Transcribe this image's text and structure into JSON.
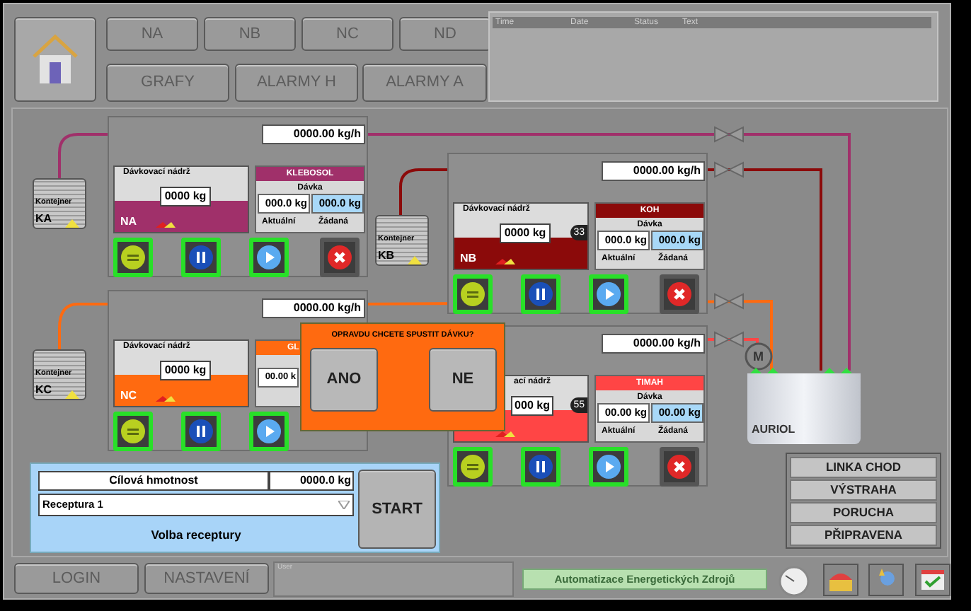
{
  "nav": {
    "row1": [
      "NA",
      "NB",
      "NC",
      "ND"
    ],
    "row2": [
      "GRAFY",
      "ALARMY H",
      "ALARMY A"
    ]
  },
  "alarm_view": {
    "columns": [
      "Time",
      "Date",
      "Status",
      "Text"
    ]
  },
  "units": [
    {
      "name": "NA",
      "color": "#a0306a",
      "tank_label": "Dávkovací nádrž",
      "tank_value": "0000 kg",
      "flow": "0000.00 kg/h",
      "recipe": {
        "title": "KLEBOSOL",
        "dose_label": "Dávka",
        "actual_value": "000.0 kg",
        "target_value": "000.0 kg",
        "actual_label": "Aktuální",
        "target_label": "Žádaná"
      },
      "buttons": [
        {
          "kind": "stop",
          "highlighted": true
        },
        {
          "kind": "pause",
          "highlighted": true
        },
        {
          "kind": "play",
          "highlighted": true
        },
        {
          "kind": "cancel",
          "highlighted": false
        }
      ]
    },
    {
      "name": "NB",
      "color": "#8b0a0a",
      "tank_label": "Dávkovací nádrž",
      "tank_value": "0000 kg",
      "badge": "33",
      "flow": "0000.00 kg/h",
      "recipe": {
        "title": "KOH",
        "dose_label": "Dávka",
        "actual_value": "000.0 kg",
        "target_value": "000.0 kg",
        "actual_label": "Aktuální",
        "target_label": "Žádaná"
      },
      "buttons": [
        {
          "kind": "stop",
          "highlighted": true
        },
        {
          "kind": "pause",
          "highlighted": true
        },
        {
          "kind": "play",
          "highlighted": true
        },
        {
          "kind": "cancel",
          "highlighted": false
        }
      ]
    },
    {
      "name": "NC",
      "color": "#ff6a10",
      "tank_label": "Dávkovací nádrž",
      "tank_value": "0000 kg",
      "flow": "0000.00 kg/h",
      "recipe": {
        "title": "GL",
        "actual_value": "00.00 k"
      },
      "buttons": [
        {
          "kind": "stop",
          "highlighted": true
        },
        {
          "kind": "pause",
          "highlighted": true
        },
        {
          "kind": "play",
          "highlighted": true
        }
      ]
    },
    {
      "color": "#ff4545",
      "tank_label": "ací nádrž",
      "tank_value": "000 kg",
      "badge": "55",
      "flow": "0000.00 kg/h",
      "recipe": {
        "title": "TIMAH",
        "dose_label": "Dávka",
        "actual_value": "00.00 kg",
        "target_value": "00.00 kg",
        "actual_label": "Aktuální",
        "target_label": "Žádaná"
      },
      "buttons": [
        {
          "kind": "stop",
          "highlighted": true
        },
        {
          "kind": "pause",
          "highlighted": true
        },
        {
          "kind": "play",
          "highlighted": true
        },
        {
          "kind": "cancel",
          "highlighted": false
        }
      ]
    }
  ],
  "containers": [
    {
      "label": "Kontejner",
      "name": "KA"
    },
    {
      "label": "Kontejner",
      "name": "KB"
    },
    {
      "label": "Kontejner",
      "name": "KC"
    }
  ],
  "product_tank": {
    "name": "AURIOL",
    "motor": "M"
  },
  "line_status": [
    "LINKA CHOD",
    "VÝSTRAHA",
    "PORUCHA",
    "PŘIPRAVENA"
  ],
  "recipe_panel": {
    "target_label": "Cílová hmotnost",
    "target_value": "0000.0 kg",
    "recipe": "Receptura 1",
    "caption": "Volba receptury",
    "start": "START"
  },
  "dialog": {
    "question": "OPRAVDU CHCETE SPUSTIT DÁVKU?",
    "yes": "ANO",
    "no": "NE"
  },
  "bottom_bar": {
    "login": "LOGIN",
    "settings": "NASTAVENÍ",
    "user_label": "User",
    "company": "Automatizace Energetických Zdrojů"
  }
}
